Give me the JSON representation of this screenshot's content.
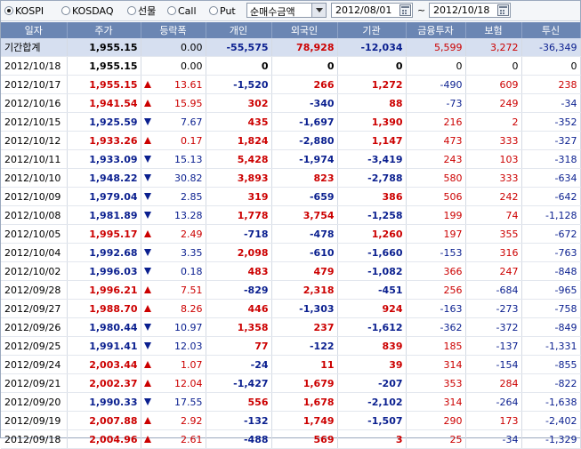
{
  "toolbar": {
    "radios": [
      {
        "label": "KOSPI",
        "checked": true
      },
      {
        "label": "KOSDAQ",
        "checked": false
      },
      {
        "label": "선물",
        "checked": false
      },
      {
        "label": "Call",
        "checked": false
      },
      {
        "label": "Put",
        "checked": false
      }
    ],
    "metric_select": "순매수금액",
    "start_date": "2012/08/01",
    "range_sep": "~",
    "end_date": "2012/10/18"
  },
  "colors": {
    "header_bg": "#6b86b3",
    "summary_bg": "#d6dff0",
    "up": "#cc0000",
    "down": "#0a1f8f"
  },
  "table": {
    "columns": [
      "일자",
      "주가",
      "등락폭",
      "개인",
      "외국인",
      "기관",
      "금융투자",
      "보험",
      "투신"
    ],
    "rows": [
      {
        "date": "기간합계",
        "price": "1,955.15",
        "dir": "",
        "change": "0.00",
        "indiv": "-55,575",
        "foreign": "78,928",
        "inst": "-12,034",
        "fin": "5,599",
        "ins": "3,272",
        "trust": "-36,349",
        "summary": true
      },
      {
        "date": "2012/10/18",
        "price": "1,955.15",
        "dir": "",
        "change": "0.00",
        "indiv": "0",
        "foreign": "0",
        "inst": "0",
        "fin": "0",
        "ins": "0",
        "trust": "0"
      },
      {
        "date": "2012/10/17",
        "price": "1,955.15",
        "dir": "up",
        "change": "13.61",
        "indiv": "-1,520",
        "foreign": "266",
        "inst": "1,272",
        "fin": "-490",
        "ins": "609",
        "trust": "238"
      },
      {
        "date": "2012/10/16",
        "price": "1,941.54",
        "dir": "up",
        "change": "15.95",
        "indiv": "302",
        "foreign": "-340",
        "inst": "88",
        "fin": "-73",
        "ins": "249",
        "trust": "-34"
      },
      {
        "date": "2012/10/15",
        "price": "1,925.59",
        "dir": "dn",
        "change": "7.67",
        "indiv": "435",
        "foreign": "-1,697",
        "inst": "1,390",
        "fin": "216",
        "ins": "2",
        "trust": "-352"
      },
      {
        "date": "2012/10/12",
        "price": "1,933.26",
        "dir": "up",
        "change": "0.17",
        "indiv": "1,824",
        "foreign": "-2,880",
        "inst": "1,147",
        "fin": "473",
        "ins": "333",
        "trust": "-327"
      },
      {
        "date": "2012/10/11",
        "price": "1,933.09",
        "dir": "dn",
        "change": "15.13",
        "indiv": "5,428",
        "foreign": "-1,974",
        "inst": "-3,419",
        "fin": "243",
        "ins": "103",
        "trust": "-318"
      },
      {
        "date": "2012/10/10",
        "price": "1,948.22",
        "dir": "dn",
        "change": "30.82",
        "indiv": "3,893",
        "foreign": "823",
        "inst": "-2,788",
        "fin": "580",
        "ins": "333",
        "trust": "-634"
      },
      {
        "date": "2012/10/09",
        "price": "1,979.04",
        "dir": "dn",
        "change": "2.85",
        "indiv": "319",
        "foreign": "-659",
        "inst": "386",
        "fin": "506",
        "ins": "242",
        "trust": "-642"
      },
      {
        "date": "2012/10/08",
        "price": "1,981.89",
        "dir": "dn",
        "change": "13.28",
        "indiv": "1,778",
        "foreign": "3,754",
        "inst": "-1,258",
        "fin": "199",
        "ins": "74",
        "trust": "-1,128"
      },
      {
        "date": "2012/10/05",
        "price": "1,995.17",
        "dir": "up",
        "change": "2.49",
        "indiv": "-718",
        "foreign": "-478",
        "inst": "1,260",
        "fin": "197",
        "ins": "355",
        "trust": "-672"
      },
      {
        "date": "2012/10/04",
        "price": "1,992.68",
        "dir": "dn",
        "change": "3.35",
        "indiv": "2,098",
        "foreign": "-610",
        "inst": "-1,660",
        "fin": "-153",
        "ins": "316",
        "trust": "-763"
      },
      {
        "date": "2012/10/02",
        "price": "1,996.03",
        "dir": "dn",
        "change": "0.18",
        "indiv": "483",
        "foreign": "479",
        "inst": "-1,082",
        "fin": "366",
        "ins": "247",
        "trust": "-848"
      },
      {
        "date": "2012/09/28",
        "price": "1,996.21",
        "dir": "up",
        "change": "7.51",
        "indiv": "-829",
        "foreign": "2,318",
        "inst": "-451",
        "fin": "256",
        "ins": "-684",
        "trust": "-965"
      },
      {
        "date": "2012/09/27",
        "price": "1,988.70",
        "dir": "up",
        "change": "8.26",
        "indiv": "446",
        "foreign": "-1,303",
        "inst": "924",
        "fin": "-163",
        "ins": "-273",
        "trust": "-758"
      },
      {
        "date": "2012/09/26",
        "price": "1,980.44",
        "dir": "dn",
        "change": "10.97",
        "indiv": "1,358",
        "foreign": "237",
        "inst": "-1,612",
        "fin": "-362",
        "ins": "-372",
        "trust": "-849"
      },
      {
        "date": "2012/09/25",
        "price": "1,991.41",
        "dir": "dn",
        "change": "12.03",
        "indiv": "77",
        "foreign": "-122",
        "inst": "839",
        "fin": "185",
        "ins": "-137",
        "trust": "-1,331"
      },
      {
        "date": "2012/09/24",
        "price": "2,003.44",
        "dir": "up",
        "change": "1.07",
        "indiv": "-24",
        "foreign": "11",
        "inst": "39",
        "fin": "314",
        "ins": "-154",
        "trust": "-855"
      },
      {
        "date": "2012/09/21",
        "price": "2,002.37",
        "dir": "up",
        "change": "12.04",
        "indiv": "-1,427",
        "foreign": "1,679",
        "inst": "-207",
        "fin": "353",
        "ins": "284",
        "trust": "-822"
      },
      {
        "date": "2012/09/20",
        "price": "1,990.33",
        "dir": "dn",
        "change": "17.55",
        "indiv": "556",
        "foreign": "1,678",
        "inst": "-2,102",
        "fin": "314",
        "ins": "-264",
        "trust": "-1,638"
      },
      {
        "date": "2012/09/19",
        "price": "2,007.88",
        "dir": "up",
        "change": "2.92",
        "indiv": "-132",
        "foreign": "1,749",
        "inst": "-1,507",
        "fin": "290",
        "ins": "173",
        "trust": "-2,402"
      },
      {
        "date": "2012/09/18",
        "price": "2,004.96",
        "dir": "up",
        "change": "2.61",
        "indiv": "-488",
        "foreign": "569",
        "inst": "3",
        "fin": "25",
        "ins": "-34",
        "trust": "-1,329"
      }
    ]
  }
}
